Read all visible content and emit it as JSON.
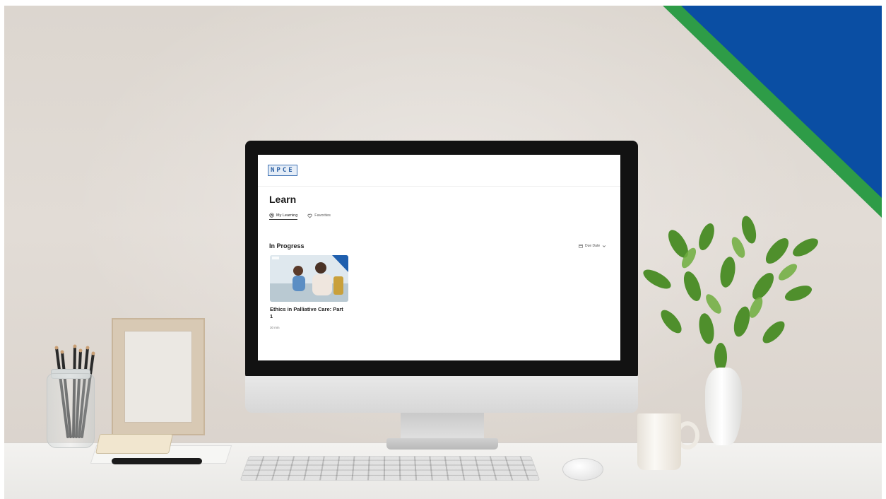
{
  "app": {
    "logo_text": "NPCE",
    "page_title": "Learn",
    "tabs": [
      {
        "label": "My Learning",
        "icon": "target-icon",
        "active": true
      },
      {
        "label": "Favorites",
        "icon": "heart-icon",
        "active": false
      }
    ],
    "section_title": "In Progress",
    "sort": {
      "label": "Due Date",
      "icon": "calendar-icon"
    },
    "card": {
      "title": "Ethics in Palliative Care: Part 1",
      "meta": "30 min"
    }
  },
  "colors": {
    "corner_blue": "#0a4ea3",
    "corner_green": "#2e9c47",
    "logo_blue": "#2a5fa3"
  }
}
